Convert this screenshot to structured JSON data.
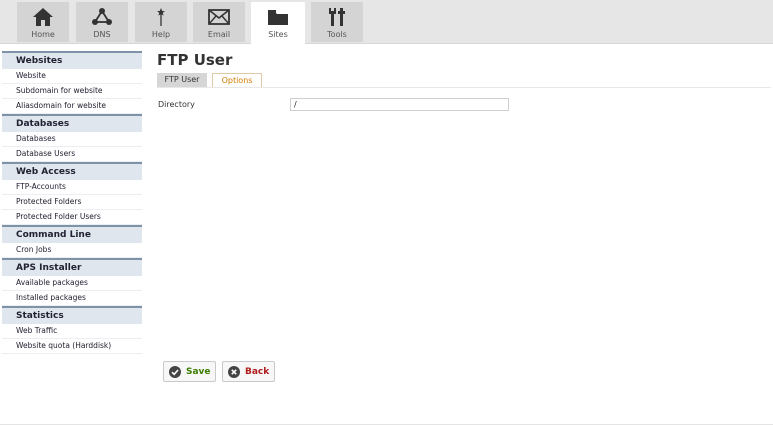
{
  "topnav": {
    "tabs": [
      {
        "label": "Home",
        "icon": "home-icon"
      },
      {
        "label": "DNS",
        "icon": "dns-icon"
      },
      {
        "label": "Help",
        "icon": "help-icon"
      },
      {
        "label": "Email",
        "icon": "email-icon"
      },
      {
        "label": "Sites",
        "icon": "folder-icon",
        "active": true
      },
      {
        "label": "Tools",
        "icon": "tools-icon"
      }
    ]
  },
  "sidebar": {
    "sections": [
      {
        "title": "Websites",
        "items": [
          "Website",
          "Subdomain for website",
          "Aliasdomain for website"
        ]
      },
      {
        "title": "Databases",
        "items": [
          "Databases",
          "Database Users"
        ]
      },
      {
        "title": "Web Access",
        "items": [
          "FTP-Accounts",
          "Protected Folders",
          "Protected Folder Users"
        ]
      },
      {
        "title": "Command Line",
        "items": [
          "Cron Jobs"
        ]
      },
      {
        "title": "APS Installer",
        "items": [
          "Available packages",
          "Installed packages"
        ]
      },
      {
        "title": "Statistics",
        "items": [
          "Web Traffic",
          "Website quota (Harddisk)"
        ]
      }
    ]
  },
  "main": {
    "title": "FTP User",
    "tabs": [
      {
        "label": "FTP User",
        "active": false
      },
      {
        "label": "Options",
        "active": true
      }
    ],
    "form": {
      "directory_label": "Directory",
      "directory_value": "/"
    },
    "buttons": {
      "save_label": "Save",
      "back_label": "Back"
    }
  },
  "colors": {
    "accent_orange": "#d47a00",
    "save_green": "#3a7d00",
    "back_red": "#b01c1c",
    "section_border": "#7f93a8"
  }
}
